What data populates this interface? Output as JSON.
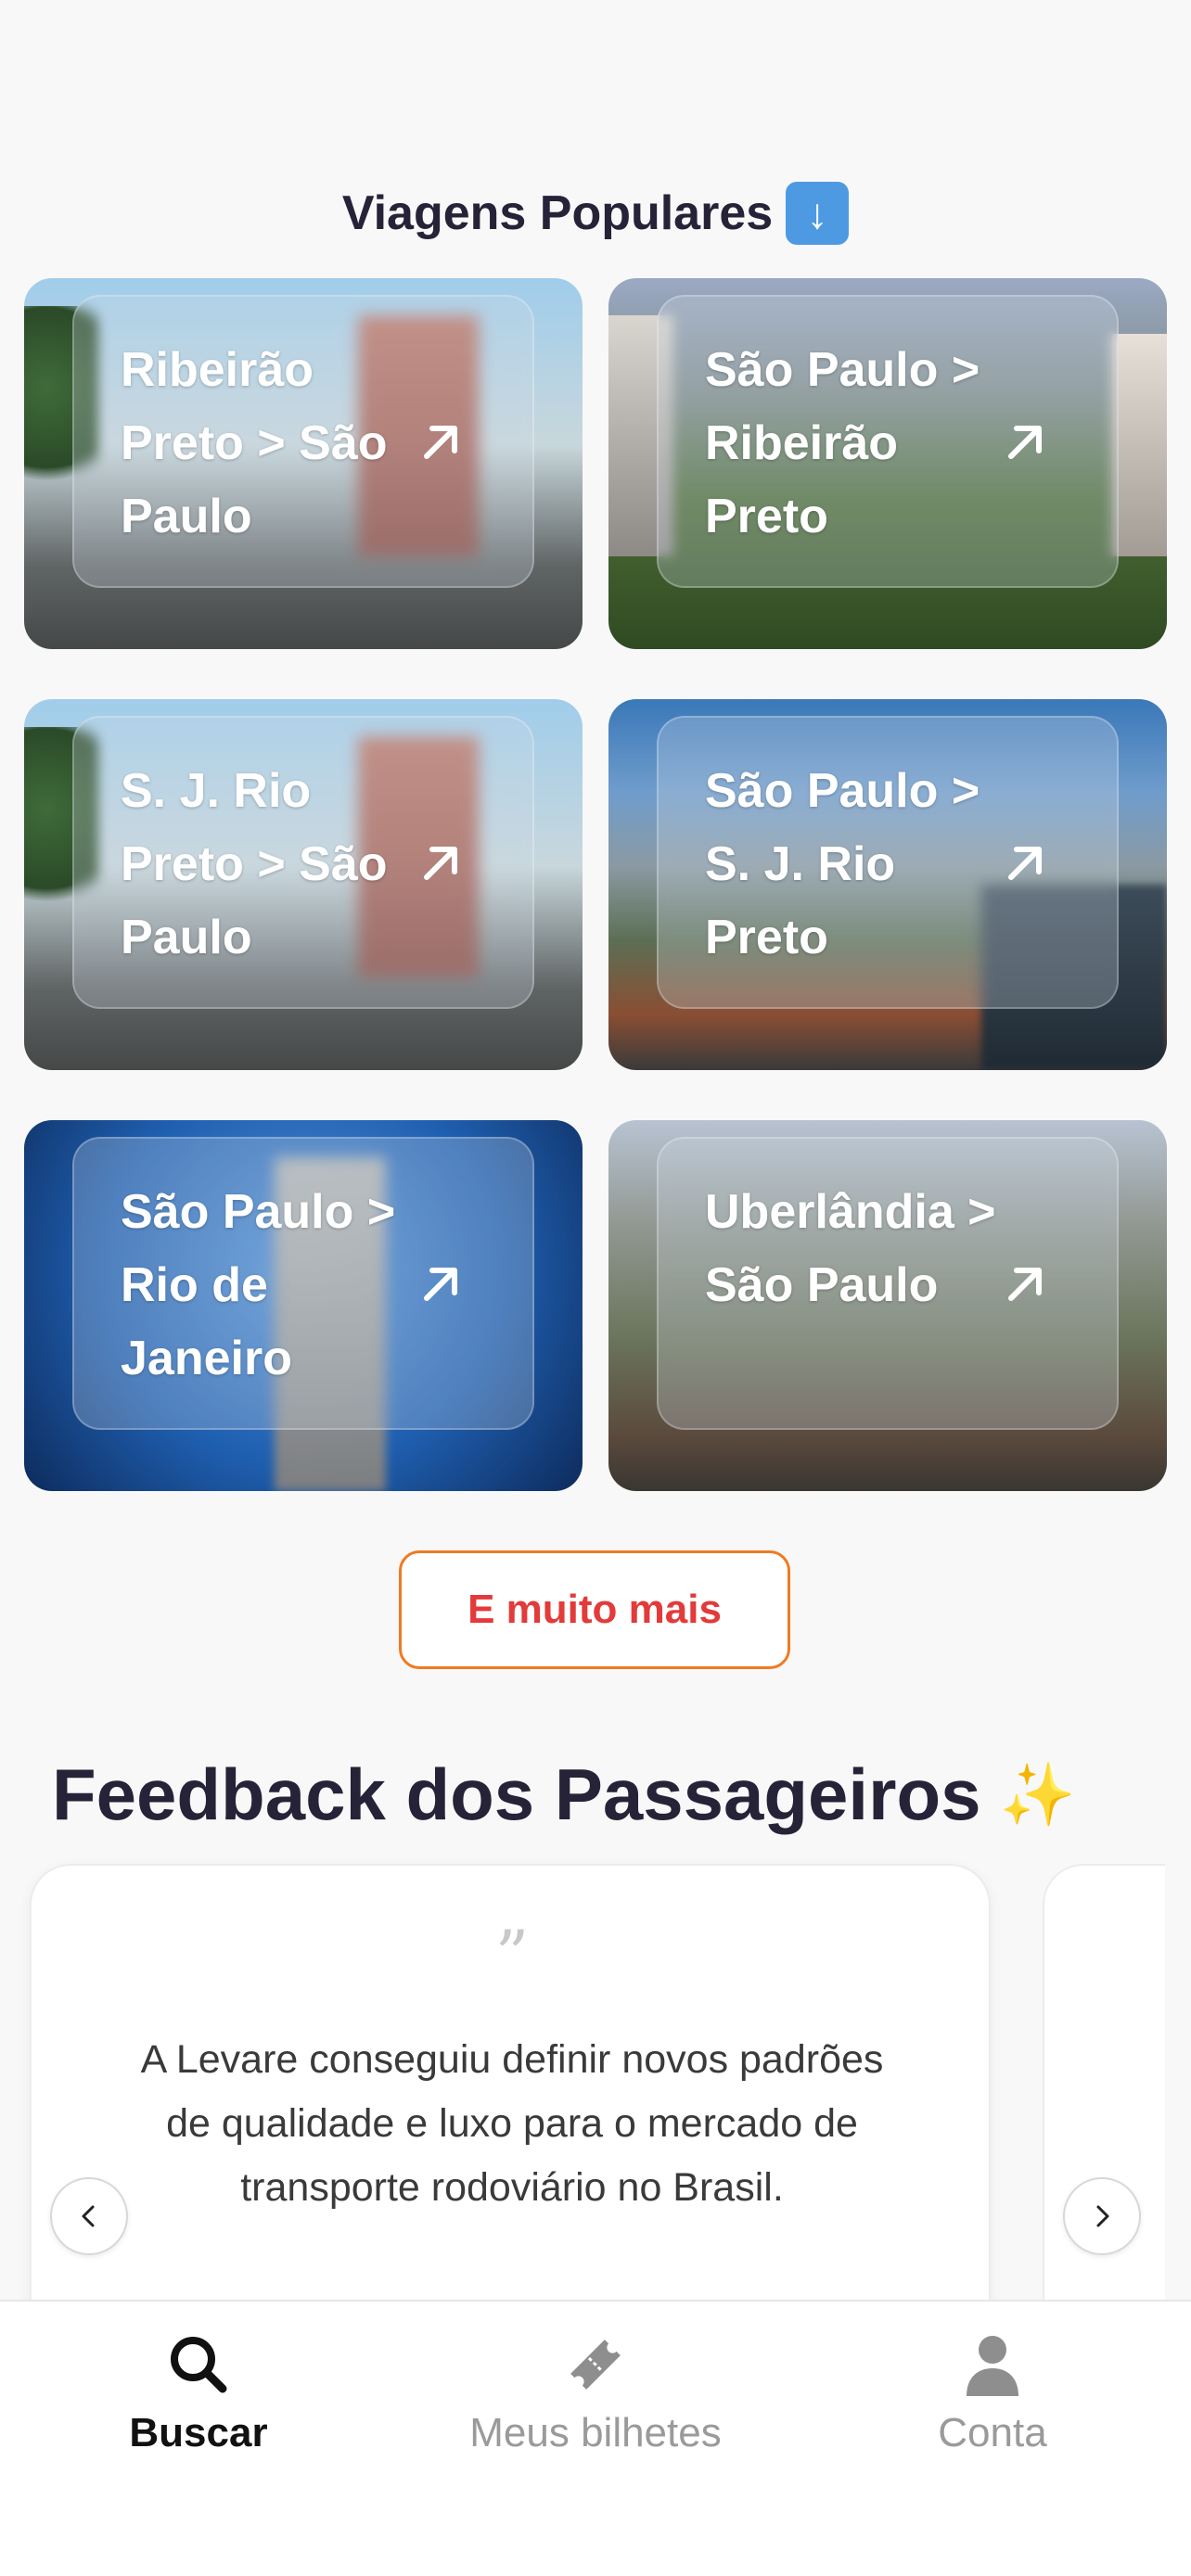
{
  "popular": {
    "title": "Viagens Populares",
    "title_icon": "down-arrow-emoji",
    "routes": [
      {
        "label": "Ribeirão Preto > São Paulo"
      },
      {
        "label": "São Paulo > Ribeirão Preto"
      },
      {
        "label": "S. J. Rio Preto > São Paulo"
      },
      {
        "label": "São Paulo > S. J. Rio Preto"
      },
      {
        "label": "São Paulo > Rio de Janeiro"
      },
      {
        "label": "Uberlândia > São Paulo"
      }
    ],
    "more_button": "E muito mais"
  },
  "feedback": {
    "title": "Feedback dos Passageiros",
    "title_icon": "sparkles-emoji",
    "quote_mark": "”",
    "quote": "A Levare conseguiu definir novos padrões de qualidade e luxo para o mercado de transporte rodoviário no Brasil."
  },
  "bottom_nav": {
    "items": [
      {
        "label": "Buscar",
        "icon": "search-icon",
        "active": true
      },
      {
        "label": "Meus bilhetes",
        "icon": "ticket-icon",
        "active": false
      },
      {
        "label": "Conta",
        "icon": "user-icon",
        "active": false
      }
    ]
  },
  "colors": {
    "accent_orange": "#f07a22",
    "accent_red": "#e33a3a",
    "title_dark": "#262338"
  }
}
